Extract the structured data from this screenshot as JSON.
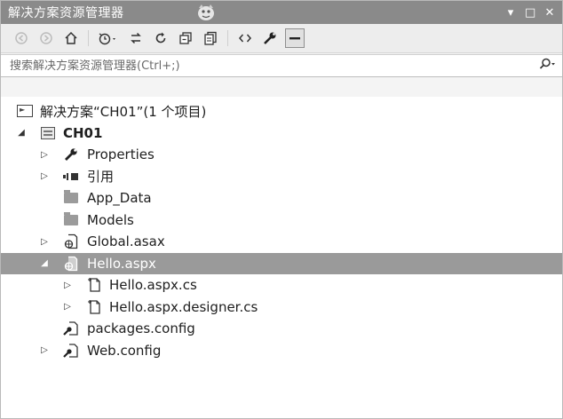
{
  "window": {
    "title": "解决方案资源管理器",
    "controls": {
      "dropdown": "▾",
      "maximize": "□",
      "close": "✕"
    }
  },
  "toolbar": {
    "icons": [
      "back-icon",
      "forward-icon",
      "home-icon",
      "history-icon",
      "sync-icon",
      "refresh-icon",
      "collapse-all-icon",
      "show-all-files-icon",
      "view-code-icon",
      "properties-icon",
      "preview-icon"
    ]
  },
  "search": {
    "placeholder": "搜索解决方案资源管理器(Ctrl+;)",
    "value": ""
  },
  "tree": {
    "solution": {
      "label": "解决方案“CH01”(1 个项目)"
    },
    "project": {
      "label": "CH01"
    },
    "items": {
      "properties": "Properties",
      "references": "引用",
      "app_data": "App_Data",
      "models": "Models",
      "global": "Global.asax",
      "hello": "Hello.aspx",
      "hello_cs": "Hello.aspx.cs",
      "hello_designer": "Hello.aspx.designer.cs",
      "packages": "packages.config",
      "webconfig": "Web.config"
    }
  },
  "colors": {
    "titlebar": "#8a8a8a",
    "selected_row": "#9a9a9a",
    "tree_background": "#ffffff"
  }
}
